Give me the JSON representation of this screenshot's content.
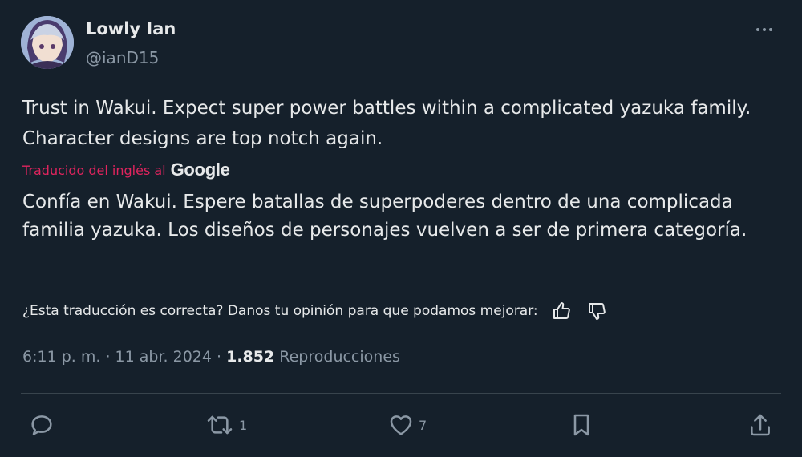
{
  "author": {
    "name": "Lowly Ian",
    "handle": "@ianD15"
  },
  "tweet": {
    "text": "Trust in Wakui. Expect super power battles within a complicated yazuka family. Character designs are top notch again."
  },
  "translation": {
    "label": "Traducido del inglés al",
    "provider": "Google",
    "text": "Confía en Wakui. Espere batallas de superpoderes dentro de una complicada familia yazuka. Los diseños de personajes vuelven a ser de primera categoría.",
    "feedback_prompt": "¿Esta traducción es correcta? Danos tu opinión para que podamos mejorar:"
  },
  "meta": {
    "time": "6:11 p. m.",
    "sep1": "·",
    "date": "11 abr. 2024",
    "sep2": "·",
    "views_count": "1.852",
    "views_label": "Reproducciones"
  },
  "actions": {
    "retweet_count": "1",
    "like_count": "7"
  },
  "colors": {
    "background": "#15202b",
    "text": "#e7e9ea",
    "secondary": "#8b98a5",
    "translated_label": "#e0245e",
    "divider": "#38444d"
  },
  "icons": [
    "avatar",
    "more-icon",
    "thumbs-up-icon",
    "thumbs-down-icon",
    "reply-icon",
    "retweet-icon",
    "like-icon",
    "bookmark-icon",
    "share-icon"
  ]
}
